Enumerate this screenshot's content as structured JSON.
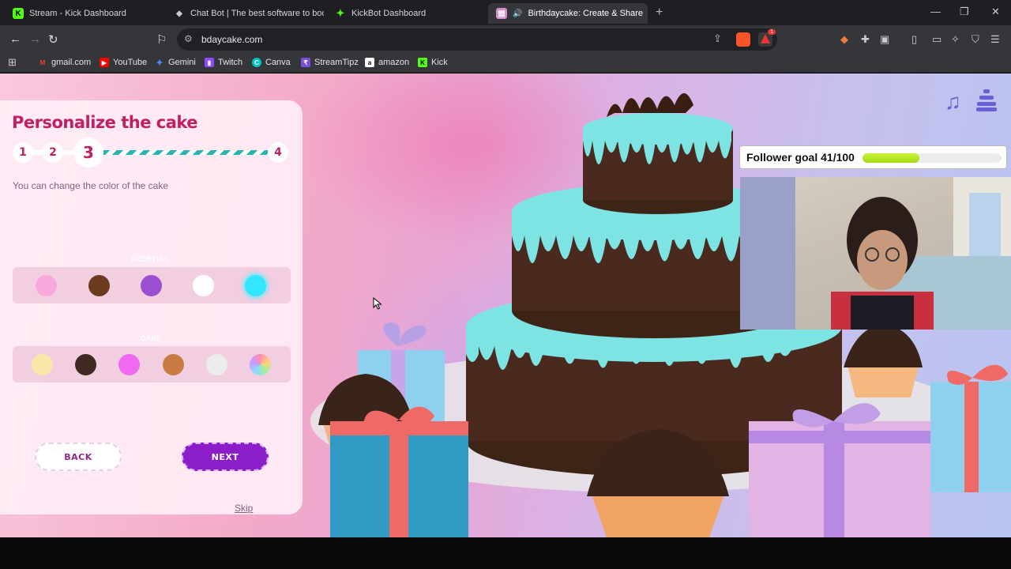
{
  "browser": {
    "tabs": [
      {
        "title": "Stream - Kick Dashboard",
        "favicon": "kick-icon",
        "color": "#53fc18",
        "glyph": "K"
      },
      {
        "title": "Chat Bot | The best software to boost",
        "favicon": "chatbot-icon",
        "color": "#cccccc",
        "glyph": "◆"
      },
      {
        "title": "KickBot Dashboard",
        "favicon": "kickbot-icon",
        "color": "#53fc18",
        "glyph": "✦"
      },
      {
        "title": "Birthdaycake: Create & Share",
        "favicon": "cake-icon",
        "color": "#d68fc9",
        "glyph": "▤"
      }
    ],
    "active_tab_audio": "🔊",
    "close_glyph": "✕",
    "new_tab_glyph": "+",
    "url": "bdaycake.com",
    "window_controls": {
      "minimize": "—",
      "maximize": "❐",
      "close": "✕"
    },
    "shield_badge": "1"
  },
  "bookmarks": [
    {
      "label": "gmail.com",
      "icon": "gmail-icon",
      "color": "#ea4335",
      "glyph": "M"
    },
    {
      "label": "YouTube",
      "icon": "youtube-icon",
      "color": "#ff0000",
      "glyph": "▶"
    },
    {
      "label": "Gemini",
      "icon": "gemini-icon",
      "color": "#4f8cf7",
      "glyph": "✦"
    },
    {
      "label": "Twitch",
      "icon": "twitch-icon",
      "color": "#9146ff",
      "glyph": "▮"
    },
    {
      "label": "Canva",
      "icon": "canva-icon",
      "color": "#00c4cc",
      "glyph": "C"
    },
    {
      "label": "StreamTipz",
      "icon": "streamtipz-icon",
      "color": "#7b4ce0",
      "glyph": "₹"
    },
    {
      "label": "amazon",
      "icon": "amazon-icon",
      "color": "#ffffff",
      "glyph": "a"
    },
    {
      "label": "Kick",
      "icon": "kick-icon",
      "color": "#53fc18",
      "glyph": "K"
    }
  ],
  "panel": {
    "title": "Personalize the cake",
    "steps": [
      "1",
      "2",
      "3",
      "4"
    ],
    "current_step": "3",
    "subtitle": "You can change the color of the cake",
    "frosting_label": "FROSTING",
    "frosting_colors": [
      "#f7a8dd",
      "#6b3a1f",
      "#9a4fd0",
      "#ffffff",
      "#33e6ff"
    ],
    "frosting_selected": 4,
    "cake_label": "CAKE",
    "cake_colors": [
      "#f8e7a6",
      "#3f2a22",
      "#ef69f1",
      "#c97b44",
      "#ececec",
      "rainbow"
    ],
    "back_label": "BACK",
    "next_label": "NEXT",
    "skip_label": "Skip"
  },
  "stream_overlay": {
    "follower_goal_label": "Follower goal 41/100",
    "follower_current": 41,
    "follower_target": 100,
    "music_icon": "♫"
  },
  "colors": {
    "accent": "#c21f63",
    "next_button": "#8b1ec9",
    "frosting": "#7ee3e3",
    "chocolate": "#4a2a1e"
  }
}
